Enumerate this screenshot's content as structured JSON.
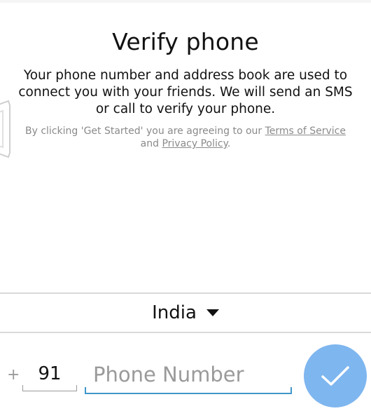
{
  "screen": {
    "title": "Verify phone",
    "description": "Your phone number and address book are used to connect you with your friends. We will send an SMS or call to verify your phone.",
    "terms": {
      "prefix": "By clicking 'Get Started' you are agreeing to our ",
      "terms_link": "Terms of Service",
      "middle": " and ",
      "privacy_link": "Privacy Policy",
      "suffix": "."
    }
  },
  "country": {
    "name": "India",
    "icon": "caret-down-icon"
  },
  "phone": {
    "plus": "+",
    "country_code": "91",
    "number_value": "",
    "number_placeholder": "Phone Number"
  },
  "submit": {
    "icon": "checkmark-icon",
    "color": "#7eb6ef"
  },
  "colors": {
    "accent": "#3f96c9",
    "fab": "#7eb6ef",
    "muted_text": "#8a8a8a"
  }
}
